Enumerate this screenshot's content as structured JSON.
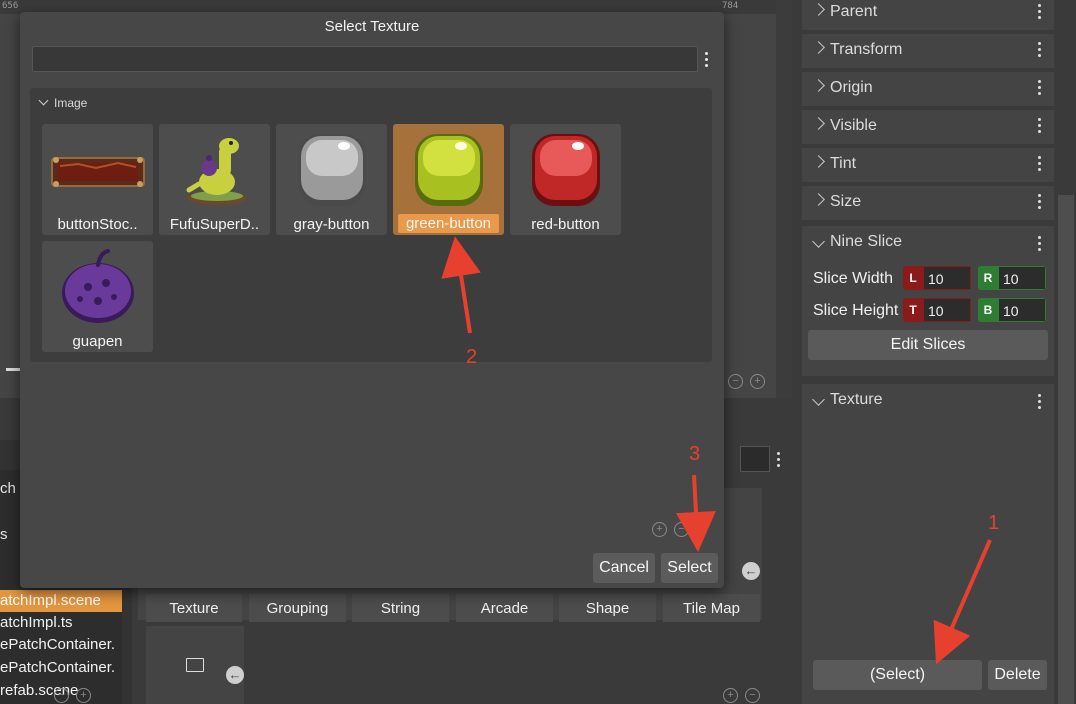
{
  "ruler": {
    "ticks": [
      "656",
      "784"
    ]
  },
  "files": [
    {
      "name": "atchImpl.scene",
      "selected": true
    },
    {
      "name": "atchImpl.ts",
      "selected": false
    },
    {
      "name": "ePatchContainer.",
      "selected": false
    },
    {
      "name": "ePatchContainer.",
      "selected": false
    },
    {
      "name": "refab.scene",
      "selected": false
    }
  ],
  "left_panel_fragments": [
    "ch",
    "s"
  ],
  "asset_tabs": [
    "Texture",
    "Grouping",
    "String",
    "Arcade",
    "Shape",
    "Tile Map"
  ],
  "inspector": {
    "sections": [
      "Parent",
      "Transform",
      "Origin",
      "Visible",
      "Tint",
      "Size"
    ],
    "nine_slice": {
      "title": "Nine Slice",
      "slice_width_label": "Slice Width",
      "slice_height_label": "Slice Height",
      "left_tag": "L",
      "left": "10",
      "right_tag": "R",
      "right": "10",
      "top_tag": "T",
      "top": "10",
      "bottom_tag": "B",
      "bottom": "10",
      "edit_button": "Edit Slices"
    },
    "texture": {
      "title": "Texture",
      "select_button": "(Select)",
      "delete_button": "Delete"
    }
  },
  "dialog": {
    "title": "Select Texture",
    "group_title": "Image",
    "items": [
      {
        "label": "buttonStoc..",
        "icon": "wood-frame-thumbnail"
      },
      {
        "label": "FufuSuperD..",
        "icon": "dinosaur-thumbnail"
      },
      {
        "label": "gray-button",
        "icon": "gray-button-thumbnail"
      },
      {
        "label": "green-button",
        "icon": "green-button-thumbnail",
        "selected": true
      },
      {
        "label": "red-button",
        "icon": "red-button-thumbnail"
      },
      {
        "label": "guapen",
        "icon": "purple-fruit-thumbnail"
      }
    ],
    "cancel_button": "Cancel",
    "select_button": "Select"
  },
  "annotations": {
    "step1": "1",
    "step2": "2",
    "step3": "3"
  },
  "colors": {
    "accent": "#e89a4a",
    "annotation": "#e8402e",
    "slice_red": "#8b1a1a",
    "slice_green": "#2e7d32"
  }
}
